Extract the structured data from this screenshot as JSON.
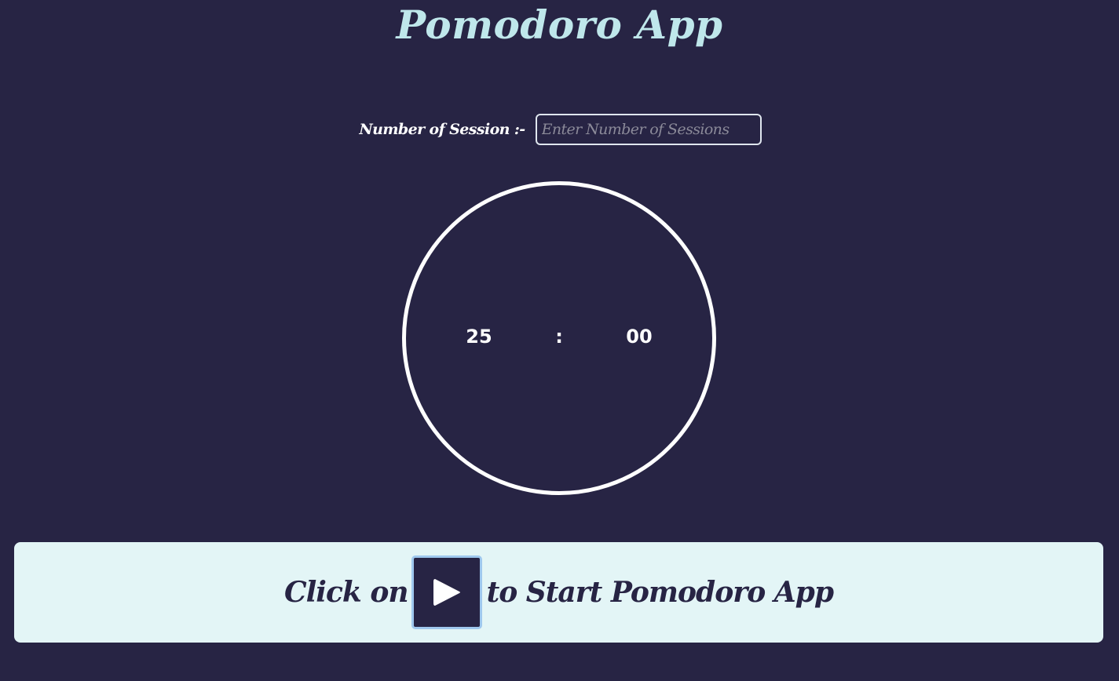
{
  "header": {
    "title": "Pomodoro App"
  },
  "session": {
    "label": "Number of Session :-",
    "input_value": "",
    "placeholder": "Enter Number of Sessions"
  },
  "timer": {
    "minutes": "25",
    "separator": ":",
    "seconds": "00"
  },
  "start_banner": {
    "text_before": "Click on",
    "text_after": "to Start Pomodoro App",
    "button_icon": "play-icon"
  },
  "colors": {
    "background": "#272444",
    "title": "#bfe7eb",
    "banner_background": "#e3f5f6",
    "play_button_border": "#9fc8ee",
    "timer_ring": "#ffffff"
  }
}
